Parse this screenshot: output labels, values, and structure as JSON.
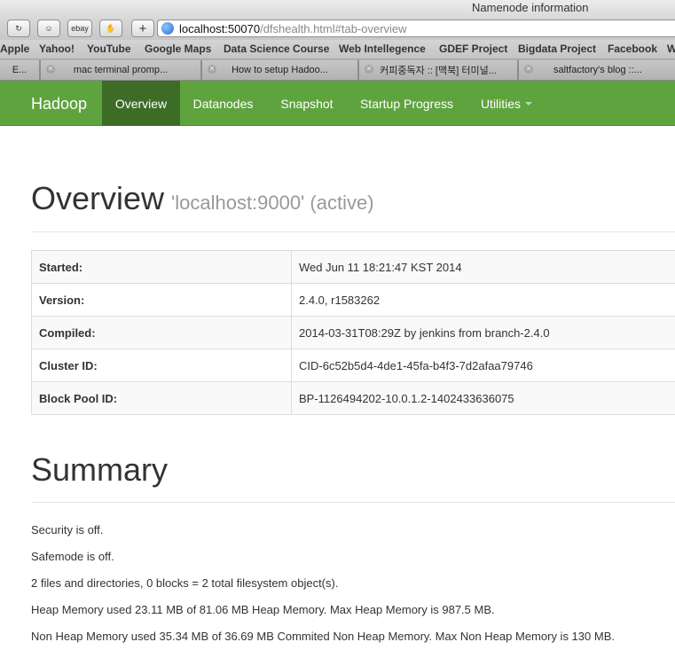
{
  "browser": {
    "window_title": "Namenode information",
    "toolbar_buttons": [
      "ebay"
    ],
    "new_tab_symbol": "+",
    "url_host": "localhost:50070",
    "url_path": "/dfshealth.html#tab-overview",
    "bookmarks": [
      "Apple",
      "Yahoo!",
      "YouTube",
      "Google Maps",
      "Data Science Course",
      "Web Intellegence",
      "GDEF Project",
      "Bigdata Project",
      "Facebook",
      "W"
    ],
    "tabs": [
      "E...",
      "mac terminal promp...",
      "How to setup Hadoo...",
      "커피중독자 :: [맥북] 터미널...",
      "saltfactory's blog ::..."
    ]
  },
  "navbar": {
    "brand": "Hadoop",
    "items": [
      "Overview",
      "Datanodes",
      "Snapshot",
      "Startup Progress",
      "Utilities"
    ],
    "active": "Overview",
    "colors": {
      "bar": "#5fa33e",
      "active": "#3d6c27"
    }
  },
  "overview": {
    "title": "Overview",
    "subtitle": "'localhost:9000' (active)",
    "rows": [
      {
        "key": "Started:",
        "value": "Wed Jun 11 18:21:47 KST 2014"
      },
      {
        "key": "Version:",
        "value": "2.4.0, r1583262"
      },
      {
        "key": "Compiled:",
        "value": "2014-03-31T08:29Z by jenkins from branch-2.4.0"
      },
      {
        "key": "Cluster ID:",
        "value": "CID-6c52b5d4-4de1-45fa-b4f3-7d2afaa79746"
      },
      {
        "key": "Block Pool ID:",
        "value": "BP-1126494202-10.0.1.2-1402433636075"
      }
    ]
  },
  "summary": {
    "title": "Summary",
    "lines": [
      "Security is off.",
      "Safemode is off.",
      "2 files and directories, 0 blocks = 2 total filesystem object(s).",
      "Heap Memory used 23.11 MB of 81.06 MB Heap Memory. Max Heap Memory is 987.5 MB.",
      "Non Heap Memory used 35.34 MB of 36.69 MB Commited Non Heap Memory. Max Non Heap Memory is 130 MB."
    ]
  }
}
